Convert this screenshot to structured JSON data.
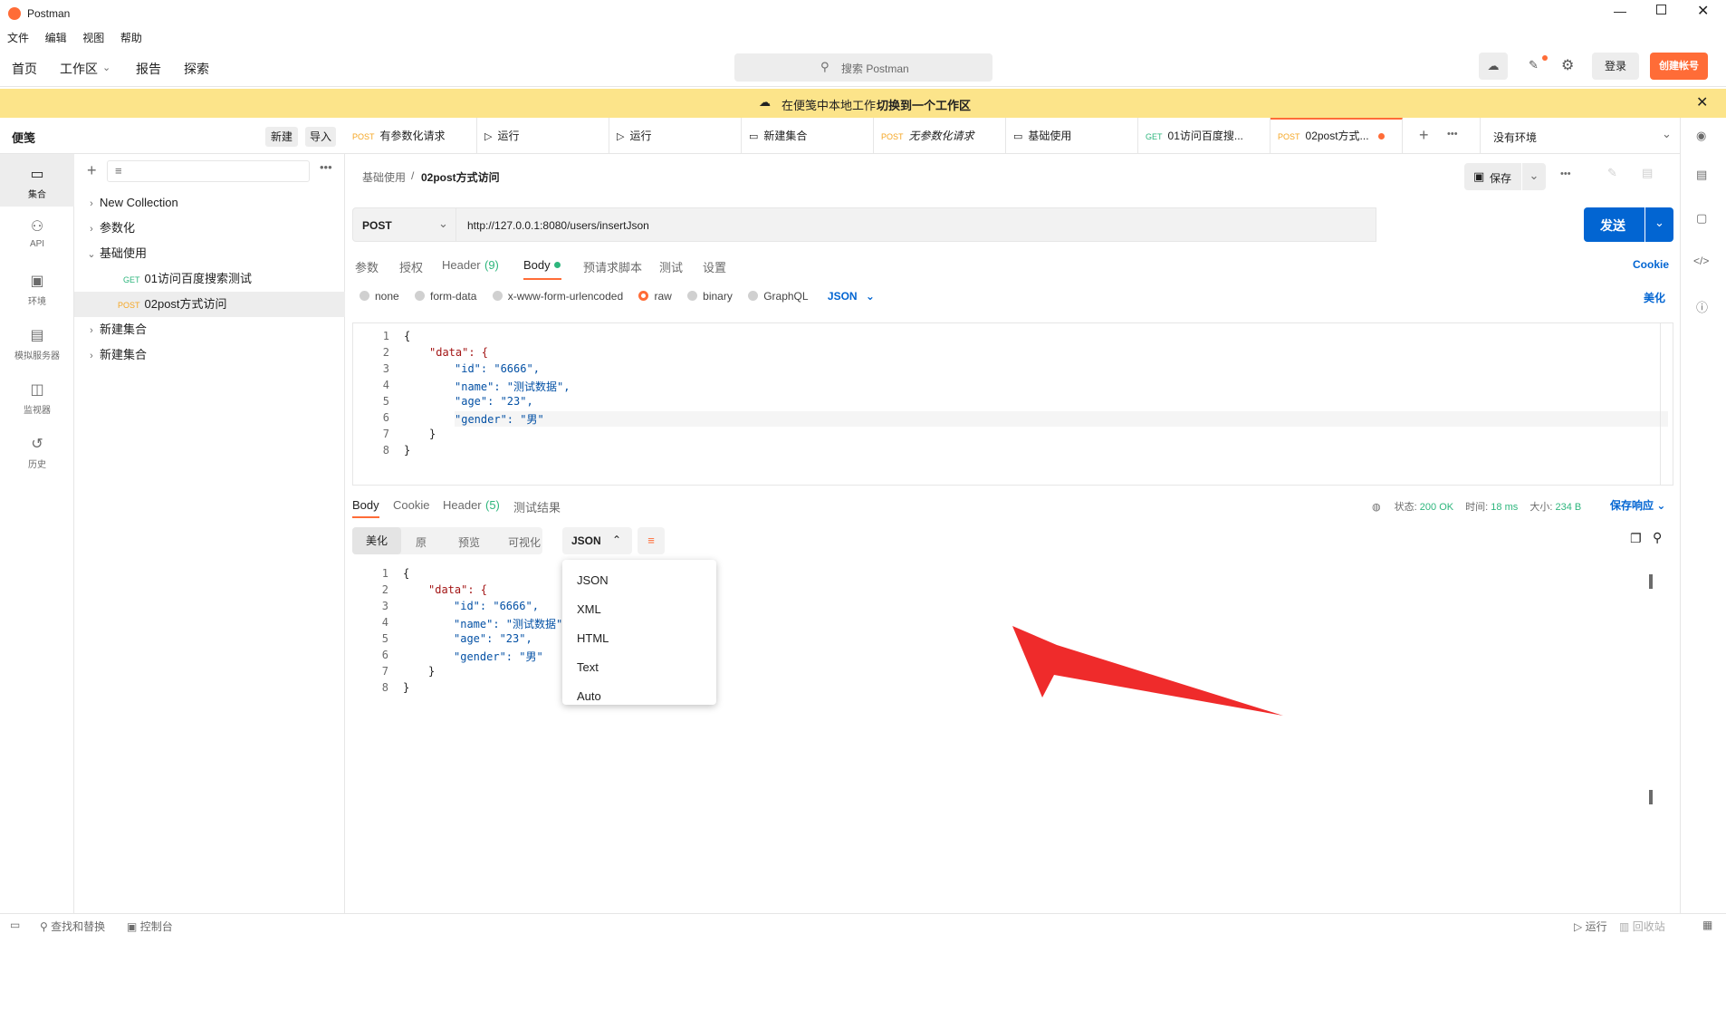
{
  "app": {
    "title": "Postman"
  },
  "menu": [
    "文件",
    "编辑",
    "视图",
    "帮助"
  ],
  "topnav": {
    "home": "首页",
    "workspace": "工作区",
    "reports": "报告",
    "explore": "探索",
    "search_placeholder": "搜索 Postman",
    "login": "登录",
    "create_account": "创建帐号"
  },
  "banner": {
    "text": "在便笺中本地工作.",
    "link": "切换到一个工作区"
  },
  "sidebar": {
    "title": "便笺",
    "new": "新建",
    "import": "导入",
    "icons": [
      "集合",
      "API",
      "环境",
      "模拟服务器",
      "监视器",
      "历史"
    ],
    "tree": [
      {
        "label": "New Collection"
      },
      {
        "label": "参数化"
      },
      {
        "label": "基础使用"
      },
      {
        "method": "GET",
        "label": "01访问百度搜索测试"
      },
      {
        "method": "POST",
        "label": "02post方式访问"
      },
      {
        "label": "新建集合"
      },
      {
        "label": "新建集合"
      }
    ]
  },
  "tabs": [
    {
      "method": "POST",
      "label": "有参数化请求"
    },
    {
      "method": "",
      "label": "运行"
    },
    {
      "method": "",
      "label": "运行"
    },
    {
      "method": "",
      "label": "新建集合"
    },
    {
      "method": "POST",
      "label": "无参数化请求"
    },
    {
      "method": "",
      "label": "基础使用"
    },
    {
      "method": "GET",
      "label": "01访问百度搜..."
    },
    {
      "method": "POST",
      "label": "02post方式..."
    }
  ],
  "env": "没有环境",
  "breadcrumb": {
    "parent": "基础使用",
    "current": "02post方式访问"
  },
  "save": "保存",
  "request": {
    "method": "POST",
    "url": "http://127.0.0.1:8080/users/insertJson",
    "send": "发送"
  },
  "req_tabs": [
    "参数",
    "授权",
    "Header",
    "(9)",
    "Body",
    "预请求脚本",
    "测试",
    "设置"
  ],
  "cookie": "Cookie",
  "body_types": [
    "none",
    "form-data",
    "x-www-form-urlencoded",
    "raw",
    "binary",
    "GraphQL"
  ],
  "body_format": "JSON",
  "beautify": "美化",
  "req_code": [
    "{",
    "\"data\": {",
    "\"id\": \"6666\",",
    "\"name\": \"测试数据\",",
    "\"age\": \"23\",",
    "\"gender\": \"男\"",
    "}",
    "}"
  ],
  "resp_tabs": [
    "Body",
    "Cookie",
    "Header",
    "(5)",
    "测试结果"
  ],
  "resp_status": {
    "status_label": "状态:",
    "status": "200 OK",
    "time_label": "时间:",
    "time": "18 ms",
    "size_label": "大小:",
    "size": "234 B",
    "save": "保存响应"
  },
  "resp_views": [
    "美化",
    "原",
    "预览",
    "可视化"
  ],
  "resp_format": "JSON",
  "resp_code": [
    "{",
    "\"data\": {",
    "\"id\": \"6666\",",
    "\"name\": \"测试数据\"",
    "\"age\": \"23\",",
    "\"gender\": \"男\"",
    "}",
    "}"
  ],
  "dropdown": [
    "JSON",
    "XML",
    "HTML",
    "Text",
    "Auto"
  ],
  "statusbar": {
    "find": "查找和替换",
    "console": "控制台",
    "runner": "运行",
    "trash": "回收站"
  },
  "colors": {
    "accent": "#ff6c37",
    "send": "#0265d2",
    "banner": "#fce48a",
    "arrow": "#ef2b2b"
  }
}
